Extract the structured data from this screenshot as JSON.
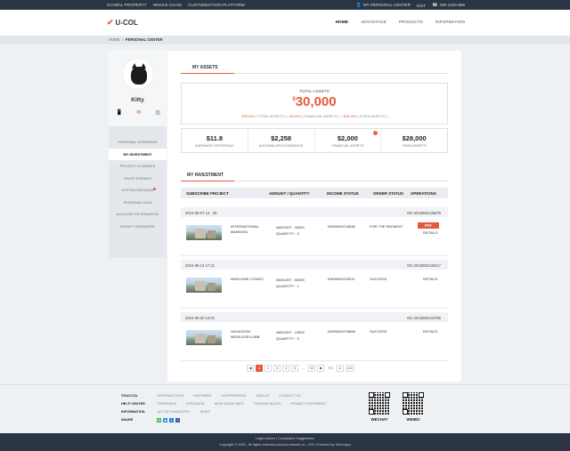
{
  "topbar": {
    "links": [
      "GLOBAL PROPERTY",
      "WHOLE CHAIN",
      "CUSTOMIZATION PLATFORM"
    ],
    "personal_center": "MY PERSONAL CENTER",
    "exit": "EXIT",
    "phone": "400-1234-666"
  },
  "nav": {
    "logo": "U-COL",
    "links": [
      "HOME",
      "ADVANTAGE",
      "PRODUCTS",
      "INFORMATION"
    ]
  },
  "breadcrumb": {
    "home": "HOME",
    "current": "PERSONAL CENTER"
  },
  "profile": {
    "name": "Kitty"
  },
  "menu": [
    "PERSONAL HOMEPAGE",
    "MY INVESTMENT",
    "PROJECT DYNAMICS",
    "INVITE FRIENDS",
    "SYSTEM MESSAGE",
    "PERSONAL DATA",
    "ACCOUNT INFORMATION",
    "MODIFY PASSWORD"
  ],
  "assets": {
    "title": "MY ASSETS",
    "total_label": "TOTAL ASSETS",
    "currency": "$",
    "total_value": "30,000",
    "b1": "$30,000",
    "b1_label": "( TOTAL ASSETS )",
    "b2": "$2,000",
    "b2_label": "( FINANCIAL ASSETS )",
    "b3": "$28,000",
    "b3_label": "( FIXED ASSETS )",
    "stats": [
      {
        "value": "$11.8",
        "label": "EARNINGS YESTERDAY"
      },
      {
        "value": "$2,258",
        "label": "ACCUMULATED EARNINGS"
      },
      {
        "value": "$2,000",
        "label": "FINANCIAL ASSETS"
      },
      {
        "value": "$28,000",
        "label": "FIXED ASSETS"
      }
    ],
    "badge": "?"
  },
  "investment": {
    "title": "MY INVESTMENT",
    "columns": [
      "SUBSCRIBE PROJECT",
      "AMOUNT / QUANTITY",
      "INCOME STATUS",
      "ORDER STATUS",
      "OPERATIONS"
    ],
    "orders": [
      {
        "date": "2015-09-07  14 : 30",
        "no": "NO.2016082135879",
        "name": "INTERNATIONAL MANSION",
        "amount": "AMOUNT : 20000",
        "quantity": "QUANTITY : 3",
        "income": "EARNINGS:$285",
        "status": "FOR THE PAYMENT",
        "pay": "PAY",
        "details": "DETAILS"
      },
      {
        "date": "2015-08-14  17:21",
        "no": "NO.2016082135417",
        "name": "MARLOWE CONDO",
        "amount": "AMOUNT : 60000",
        "quantity": "QUANTITY : 1",
        "income": "EARNINGS:$247",
        "status": "SUCCESS",
        "details": "DETAILS"
      },
      {
        "date": "2015-06-20  13:01",
        "no": "NO.2016082134785",
        "name": "HILINGDON MIDDLESEX,UBB",
        "amount": "AMOUNT : 10000",
        "quantity": "QUANTITY : 5",
        "income": "EARNINGS:$896",
        "status": "SUCCESS",
        "details": "DETAILS"
      }
    ]
  },
  "pager": {
    "prev": "◀",
    "pages": [
      "1",
      "2",
      "3",
      "4",
      "5"
    ],
    "ellipsis": "...",
    "last": "10",
    "next": "▶",
    "to_label": "TO",
    "to_value": "8",
    "go": "GO"
  },
  "footer": {
    "rows": [
      {
        "head": "YOUCCOL",
        "items": [
          "INTRODUCTION",
          "PARTNERS",
          "COOPERATION",
          "JOIN US",
          "CONTACT US"
        ]
      },
      {
        "head": "HELP CENTER",
        "items": [
          "PROBLEMS",
          "FEEDBACK",
          "NEW GUIDELINES",
          "TRADING RULES",
          "PRIVACY STATEMENT"
        ]
      },
      {
        "head": "INFORMATION",
        "items": [
          "ACTIVITYINDUSTRY",
          "NEWS"
        ]
      },
      {
        "head": "SHARE",
        "items": []
      }
    ],
    "qr1": "WECHAT",
    "qr2": "WEIBO",
    "legal": "Legal notices  |  Complaints Suggestions",
    "copyright": "Copyright © 2015  ,  All rights reserved youccol network co., LTD  |  Powered by Xinhongru"
  },
  "colors": {
    "accent": "#e65a3c",
    "dark": "#2a3442"
  }
}
